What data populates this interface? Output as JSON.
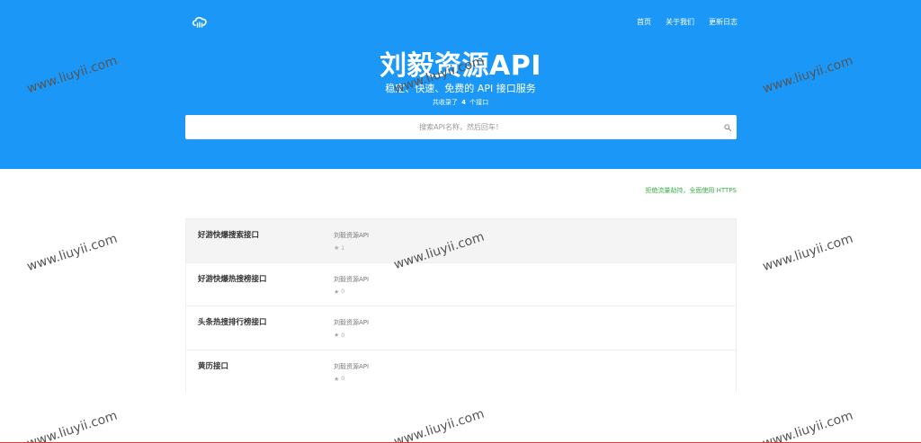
{
  "brand": {
    "logo_icon": "cloud-icon"
  },
  "nav": [
    "首页",
    "关于我们",
    "更新日志"
  ],
  "hero": {
    "title": "刘毅资源API",
    "subtitle": "稳定、快速、免费的 API 接口服务",
    "count_prefix": "共收录了",
    "count": "4",
    "count_suffix": "个接口"
  },
  "search": {
    "placeholder": "搜索API名称，然后回车！",
    "icon": "search-icon"
  },
  "https_notice": "拒绝流量劫持，全面使用 HTTPS",
  "apis": [
    {
      "name": "好游快爆搜索接口",
      "author": "刘毅资源API",
      "stars": "1"
    },
    {
      "name": "好游快爆热搜榜接口",
      "author": "刘毅资源API",
      "stars": "0"
    },
    {
      "name": "头条热搜排行榜接口",
      "author": "刘毅资源API",
      "stars": "0"
    },
    {
      "name": "黄历接口",
      "author": "刘毅资源API",
      "stars": "0"
    }
  ],
  "watermark": "www.liuyii.com",
  "colors": {
    "hero_bg": "#1b98f7",
    "https_green": "#3cae4a",
    "active_row": "#f4f4f4"
  }
}
